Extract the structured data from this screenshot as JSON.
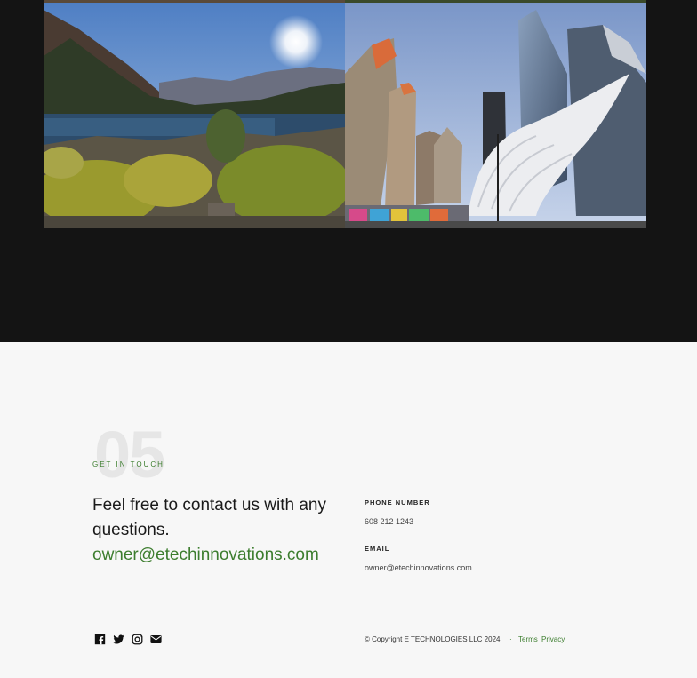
{
  "gallery": {
    "photo_1_alt": "Mountain lake with yellow shrubs",
    "photo_2_alt": "Skyscrapers and the Oculus building"
  },
  "contact": {
    "section_number": "05",
    "eyebrow": "GET IN TOUCH",
    "headline": "Feel free to contact us with any questions.",
    "email_link": "owner@etechinnovations.com",
    "phone_label": "PHONE NUMBER",
    "phone_value": "608 212 1243",
    "email_label": "EMAIL",
    "email_value": "owner@etechinnovations.com"
  },
  "footer": {
    "copyright": "© Copyright E TECHNOLOGIES LLC 2024",
    "separator": "·",
    "terms": "Terms",
    "privacy": "Privacy",
    "social_icons": [
      "facebook-icon",
      "twitter-icon",
      "instagram-icon",
      "mail-icon"
    ]
  },
  "colors": {
    "dark_bg": "#141414",
    "light_bg": "#f7f7f7",
    "accent_green": "#3c7d2e"
  }
}
